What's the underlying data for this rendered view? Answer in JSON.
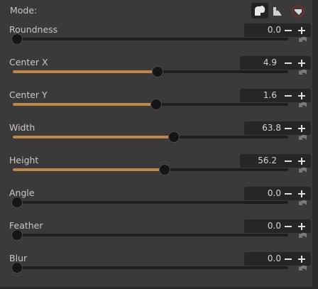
{
  "mode": {
    "label": "Mode:",
    "buttons": [
      {
        "name": "mode-combined-icon",
        "active": true
      },
      {
        "name": "mode-notch-icon",
        "active": false
      },
      {
        "name": "mode-flag-icon",
        "active": false
      }
    ]
  },
  "colors": {
    "accent": "#c0874a",
    "track": "#1e1e1e",
    "panel": "#3a3a3a"
  },
  "controls": [
    {
      "id": "roundness",
      "label": "Roundness",
      "value": "0.0",
      "level": 0.0,
      "filled": false
    },
    {
      "id": "center-x",
      "label": "Center X",
      "value": "4.9",
      "level": 0.51,
      "filled": true
    },
    {
      "id": "center-y",
      "label": "Center Y",
      "value": "1.6",
      "level": 0.505,
      "filled": true
    },
    {
      "id": "width",
      "label": "Width",
      "value": "63.8",
      "level": 0.57,
      "filled": true
    },
    {
      "id": "height",
      "label": "Height",
      "value": "56.2",
      "level": 0.535,
      "filled": true
    },
    {
      "id": "angle",
      "label": "Angle",
      "value": "0.0",
      "level": 0.0,
      "filled": false
    },
    {
      "id": "feather",
      "label": "Feather",
      "value": "0.0",
      "level": 0.0,
      "filled": false
    },
    {
      "id": "blur",
      "label": "Blur",
      "value": "0.0",
      "level": 0.0,
      "filled": false
    }
  ]
}
